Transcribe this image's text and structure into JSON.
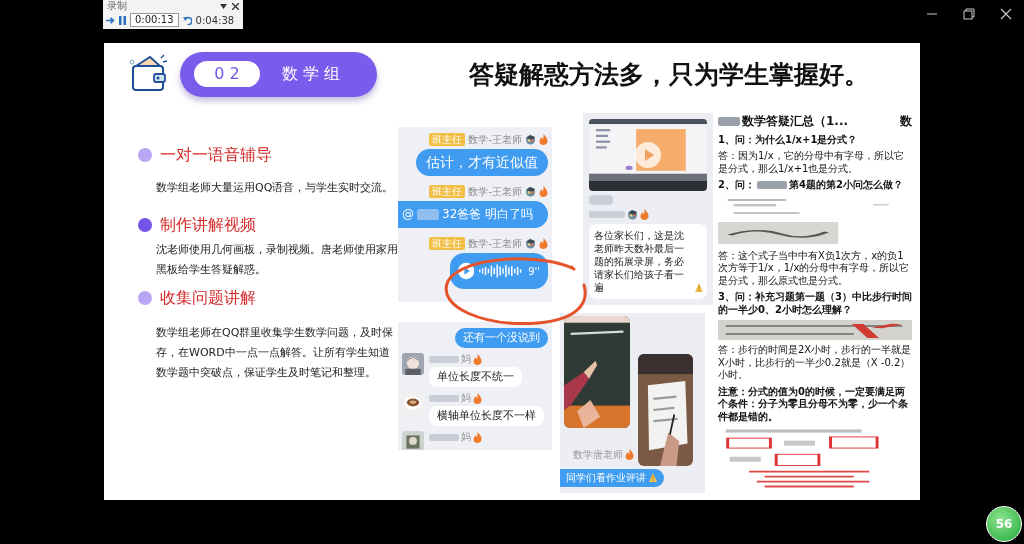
{
  "recorder": {
    "title": "录制",
    "elapsed": "0:00:13",
    "total": "0:04:38"
  },
  "counter_badge": "56",
  "slide": {
    "group": {
      "number": "0 2",
      "name": "数 学 组"
    },
    "title": "答疑解惑方法多，只为学生掌握好。",
    "sections": [
      {
        "heading": "一对一语音辅导",
        "body": "数学组老师大量运用QQ语音，与学生实时交流。",
        "color": "#b9a7f5"
      },
      {
        "heading": "制作讲解视频",
        "body": "沈老师使用几何画板，录制视频。唐老师使用家用黑板给学生答疑解惑。",
        "color": "#7454e8"
      },
      {
        "heading": "收集问题讲解",
        "body": "数学组老师在QQ群里收集学生数学问题，及时保存，在WORD中一点一点解答。让所有学生知道数学题中突破点，保证学生及时笔记和整理。",
        "color": "#b9a7f5"
      }
    ],
    "voice_chat": {
      "messages": [
        {
          "kind": "text",
          "tag": "班主任",
          "sender": "数学-王老师",
          "text": "估计，才有近似值"
        },
        {
          "kind": "mention",
          "tag": "班主任",
          "sender": "数学-王老师",
          "mention": "@",
          "text": "32爸爸 明白了吗"
        },
        {
          "kind": "voice",
          "tag": "班主任",
          "sender": "数学-王老师",
          "duration": "9''"
        }
      ]
    },
    "group_chat": {
      "messages": [
        {
          "kind": "outgoing",
          "text": "还有一个没说到"
        },
        {
          "kind": "incoming",
          "sender": "妈",
          "text": "单位长度不统一"
        },
        {
          "kind": "incoming",
          "sender": "妈",
          "text": "横轴单位长度不一样"
        },
        {
          "kind": "incoming",
          "sender": "妈"
        }
      ]
    },
    "video_post": {
      "text": "各位家长们，这是沈老师昨天数补最后一题的拓展录屏，务必请家长们给孩子看一遍"
    },
    "homework_post": {
      "sender": "数学唐老师",
      "text": "同学们看作业评讲"
    },
    "document": {
      "title": "数学答疑汇总（1...",
      "title_cut": "数",
      "blocks": [
        {
          "kind": "question",
          "text": "1、问：为什么1/x+1是分式？"
        },
        {
          "kind": "answer",
          "text": "答：因为1/x，它的分母中有字母，所以它是分式，那么1/x+1也是分式。"
        },
        {
          "kind": "question",
          "lead": "2、问：",
          "text": "第4题的第2小问怎么做？"
        },
        {
          "kind": "figure"
        },
        {
          "kind": "answer",
          "text": "答：这个式子当中中有X负1次方，x的负1次方等于1/x，1/x的分母中有字母，所以它是分式，那么原式也是分式。"
        },
        {
          "kind": "question",
          "text": "3、问：补充习题第一题（3）中比步行时间的一半少0、2小时怎么理解？"
        },
        {
          "kind": "figure"
        },
        {
          "kind": "answer",
          "text": "答：步行的时间是2X小时，步行的一半就是X小时，比步行的一半少0.2就是（X -0.2）小时。"
        },
        {
          "kind": "note",
          "text": "注意：分式的值为0的时候，一定要满足两个条件：分子为零且分母不为零，少一个条件都是错的。"
        },
        {
          "kind": "figure"
        }
      ]
    }
  }
}
